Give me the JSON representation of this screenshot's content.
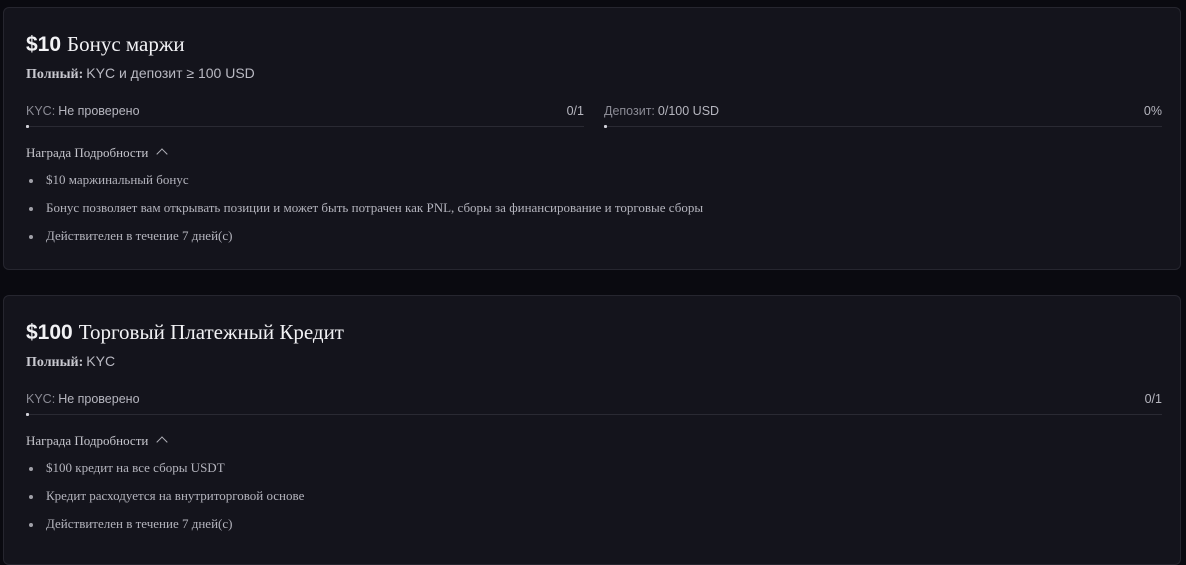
{
  "cards": [
    {
      "amount": "$10",
      "title": "Бонус маржи",
      "subtitle_label": "Полный:",
      "subtitle_value": "KYC и депозит ≥ 100 USD",
      "progress": [
        {
          "label": "KYC:",
          "value": "Не проверено",
          "count": "0/1",
          "fraction": 0.0
        },
        {
          "label": "Депозит:",
          "value": "0/100 USD",
          "count": "0%",
          "fraction": 0.0
        }
      ],
      "details_label": "Награда Подробности",
      "bullets": [
        "$10 маржинальный бонус",
        "Бонус позволяет вам открывать позиции и может быть потрачен как PNL, сборы за финансирование и торговые сборы",
        "Действителен в течение 7 дней(с)"
      ]
    },
    {
      "amount": "$100",
      "title": "Торговый Платежный Кредит",
      "subtitle_label": "Полный:",
      "subtitle_value": "KYC",
      "progress": [
        {
          "label": "KYC:",
          "value": "Не проверено",
          "count": "0/1",
          "fraction": 0.0
        }
      ],
      "details_label": "Награда Подробности",
      "bullets": [
        "$100 кредит на все сборы USDT",
        "Кредит расходуется на внутриторговой основе",
        "Действителен в течение 7 дней(с)"
      ]
    }
  ],
  "colors": {
    "background": "#0a0a10",
    "card": "#14141c",
    "progress_fill": "#d0d0d8"
  },
  "icons": {
    "details_toggle": "chevron-up-icon",
    "bullet": "bullet-dot-icon"
  }
}
